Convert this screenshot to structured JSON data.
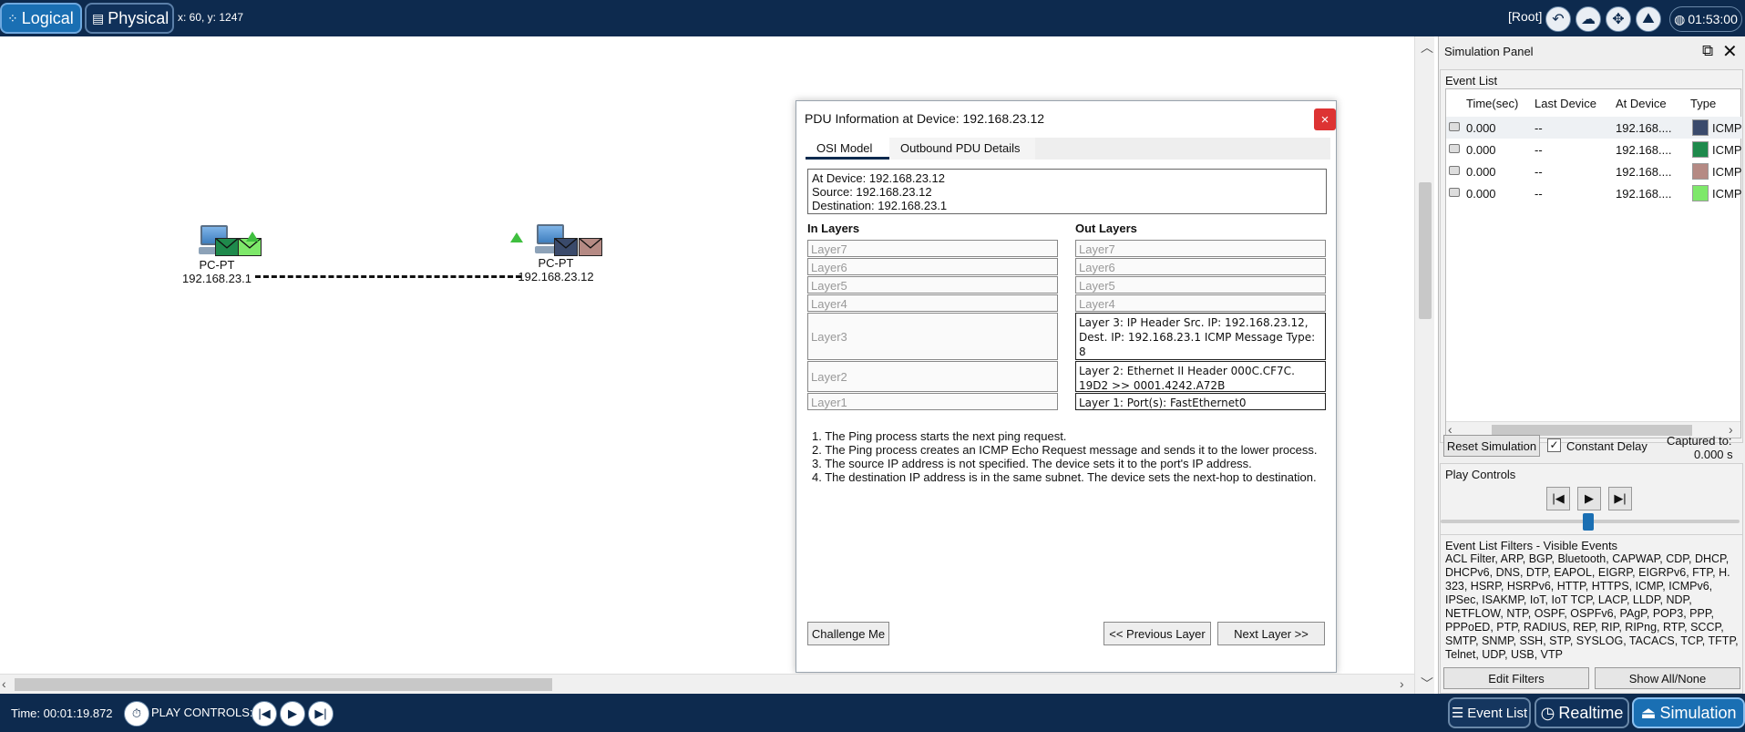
{
  "topbar": {
    "logical_label": "Logical",
    "physical_label": "Physical",
    "coords": "x: 60, y: 1247",
    "root_label": "[Root]",
    "clock": "01:53:00"
  },
  "workspace": {
    "devices": [
      {
        "name": "PC-PT",
        "ip": "192.168.23.1"
      },
      {
        "name": "PC-PT",
        "ip": "192.168.23.12"
      }
    ]
  },
  "pdu": {
    "title": "PDU Information at Device: 192.168.23.12",
    "close": "×",
    "tabs": [
      "OSI Model",
      "Outbound PDU Details"
    ],
    "info": [
      "At Device: 192.168.23.12",
      "Source: 192.168.23.12",
      "Destination: 192.168.23.1"
    ],
    "in_layers_head": "In Layers",
    "out_layers_head": "Out Layers",
    "in_layers": [
      "Layer7",
      "Layer6",
      "Layer5",
      "Layer4",
      "Layer3",
      "Layer2",
      "Layer1"
    ],
    "out_layers": [
      "Layer7",
      "Layer6",
      "Layer5",
      "Layer4",
      "Layer 3: IP Header Src. IP: 192.168.23.12, Dest. IP: 192.168.23.1 ICMP Message Type: 8",
      "Layer 2: Ethernet II Header 000C.CF7C. 19D2 >> 0001.4242.A72B",
      "Layer 1: Port(s): FastEthernet0"
    ],
    "steps": [
      "1. The Ping process starts the next ping request.",
      "2. The Ping process creates an ICMP Echo Request message and sends it to the lower process.",
      "3. The source IP address is not specified. The device sets it to the port's IP address.",
      "4. The destination IP address is in the same subnet. The device sets the next-hop to destination."
    ],
    "challenge_label": "Challenge Me",
    "prev_label": "<< Previous Layer",
    "next_label": "Next Layer >>"
  },
  "sim": {
    "title": "Simulation Panel",
    "event_list_title": "Event List",
    "columns": [
      "Time(sec)",
      "Last Device",
      "At Device",
      "Type"
    ],
    "events": [
      {
        "time": "0.000",
        "last": "--",
        "at": "192.168....",
        "type": "ICMP",
        "color": "#3a4a6b"
      },
      {
        "time": "0.000",
        "last": "--",
        "at": "192.168....",
        "type": "ICMP",
        "color": "#1f8a4c"
      },
      {
        "time": "0.000",
        "last": "--",
        "at": "192.168....",
        "type": "ICMP",
        "color": "#b58a84"
      },
      {
        "time": "0.000",
        "last": "--",
        "at": "192.168....",
        "type": "ICMP",
        "color": "#7ee86a"
      }
    ],
    "reset_label": "Reset Simulation",
    "constant_delay_label": "Constant Delay",
    "constant_delay_checked": true,
    "captured_label": "Captured to:",
    "captured_value": "0.000 s",
    "play_controls_title": "Play Controls",
    "filters_title": "Event List Filters - Visible Events",
    "filters_text": "ACL Filter, ARP, BGP, Bluetooth, CAPWAP, CDP, DHCP, DHCPv6, DNS, DTP, EAPOL, EIGRP, EIGRPv6, FTP, H. 323, HSRP, HSRPv6, HTTP, HTTPS, ICMP, ICMPv6, IPSec, ISAKMP, IoT, IoT TCP, LACP, LLDP, NDP, NETFLOW, NTP, OSPF, OSPFv6, PAgP, POP3, PPP, PPPoED, PTP, RADIUS, REP, RIP, RIPng, RTP, SCCP, SMTP, SNMP, SSH, STP, SYSLOG, TACACS, TCP, TFTP, Telnet, UDP, USB, VTP",
    "edit_filters_label": "Edit Filters",
    "show_all_label": "Show All/None"
  },
  "bottombar": {
    "time": "Time: 00:01:19.872",
    "play_controls_label": "PLAY CONTROLS:",
    "event_list_label": "Event List",
    "realtime_label": "Realtime",
    "simulation_label": "Simulation"
  },
  "colors": {
    "bar_bg": "#0d2a4e",
    "accent": "#1a6fb3",
    "close_red": "#d33333"
  }
}
